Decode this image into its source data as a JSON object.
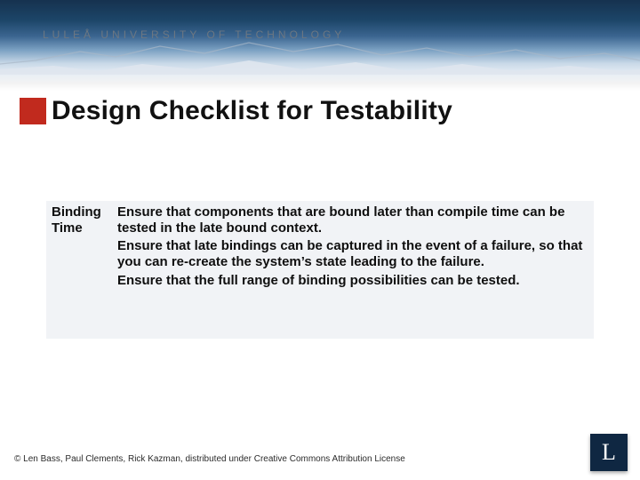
{
  "header": {
    "university": "LULEÅ UNIVERSITY OF TECHNOLOGY"
  },
  "title": "Design Checklist for Testability",
  "table": {
    "label": "Binding Time",
    "p1": "Ensure that components that are bound later than compile time can be tested in the late bound context.",
    "p2": "Ensure that late bindings can be captured in the event of a failure, so that you can re-create the system’s state leading to the failure.",
    "p3": "Ensure that the full range of binding possibilities can be tested."
  },
  "footer": "© Len Bass, Paul Clements, Rick Kazman, distributed under Creative Commons Attribution License",
  "logo_letter": "L"
}
